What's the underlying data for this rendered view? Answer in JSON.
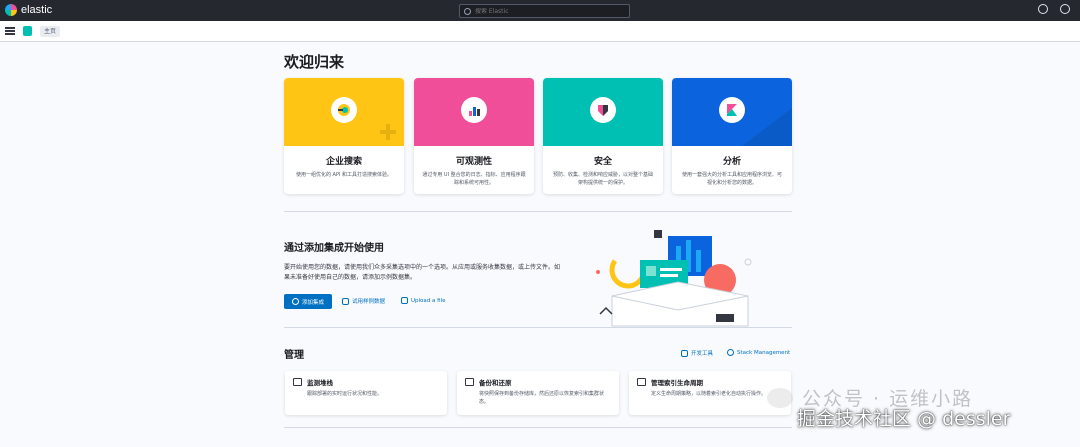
{
  "header": {
    "logo_text": "elastic",
    "search_placeholder": "搜索 Elastic"
  },
  "breadcrumb": {
    "home": "主页"
  },
  "page": {
    "title": "欢迎归来"
  },
  "solutions": [
    {
      "title": "企业搜索",
      "desc": "使用一组优化的 API 和工具打造搜索体验。",
      "color": "#fec514"
    },
    {
      "title": "可观测性",
      "desc": "通过专用 UI 整合您的日志、指标、应用程序跟踪和系统可用性。",
      "color": "#f04e98"
    },
    {
      "title": "安全",
      "desc": "预防、收集、检测和响应威胁，以对整个基础架构提供统一的保护。",
      "color": "#00bfb3"
    },
    {
      "title": "分析",
      "desc": "使用一套强大的分析工具和应用程序浏览、可视化和分析您的数据。",
      "color": "#0b64dd"
    }
  ],
  "integrations": {
    "title": "通过添加集成开始使用",
    "desc": "要开始使用您的数据，请使用我们众多采集选项中的一个选项。从应用或服务收集数据，或上传文件。如果未准备好使用自己的数据，请添加示例数据集。",
    "add_button": "添加集成",
    "sample_link": "试用样例数据",
    "upload_link": "Upload a file"
  },
  "management": {
    "title": "管理",
    "dev_tools": "开发工具",
    "stack_mgmt": "Stack Management",
    "cards": [
      {
        "title": "监测堆栈",
        "desc": "跟踪部署的实时运行状况和性能。"
      },
      {
        "title": "备份和还原",
        "desc": "将快照保存到备份存储库，然后还原以恢复索引和集群状态。"
      },
      {
        "title": "管理索引生命周期",
        "desc": "定义生命周期策略，以随着索引老化自动执行操作。"
      }
    ]
  },
  "watermark": {
    "line1": "公众号 · 运维小路",
    "line2": "掘金技术社区 @ dessler"
  }
}
